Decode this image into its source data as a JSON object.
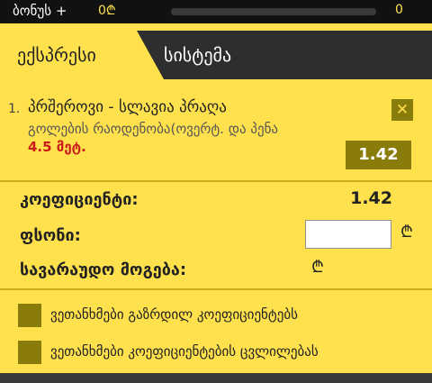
{
  "topbar": {
    "bonus_label": "ბონუს +",
    "bonus_value": "0₾",
    "bonus_count": "0",
    "progress": 0
  },
  "tabs": {
    "express": "ექსპრესი",
    "system": "სისტემა",
    "active": "express"
  },
  "bet": {
    "number": "1.",
    "event": "პრშეროვი - სლავია პრაღა",
    "market": "გოლების რაოდენობა(ოვერტ. და პენა",
    "pick": "4.5 მეტ.",
    "odd": "1.42",
    "close_symbol": "✕"
  },
  "summary": {
    "coef_label": "კოეფიციენტი:",
    "coef_value": "1.42",
    "stake_label": "ფსონი:",
    "stake_value": "",
    "win_label": "სავარაუდო მოგება:",
    "currency": "₾"
  },
  "options": [
    {
      "label": "ვეთანხმები გაზრდილ კოეფიციენტებს",
      "checked": false
    },
    {
      "label": "ვეთანხმები კოეფიციენტების ცვლილებას",
      "checked": false
    }
  ],
  "colors": {
    "accent": "#ffe04d",
    "checkbox": "#8a7c0a",
    "pick_text": "#cc1b1b",
    "topbar": "#111111",
    "tabbar": "#2e2e2e"
  }
}
